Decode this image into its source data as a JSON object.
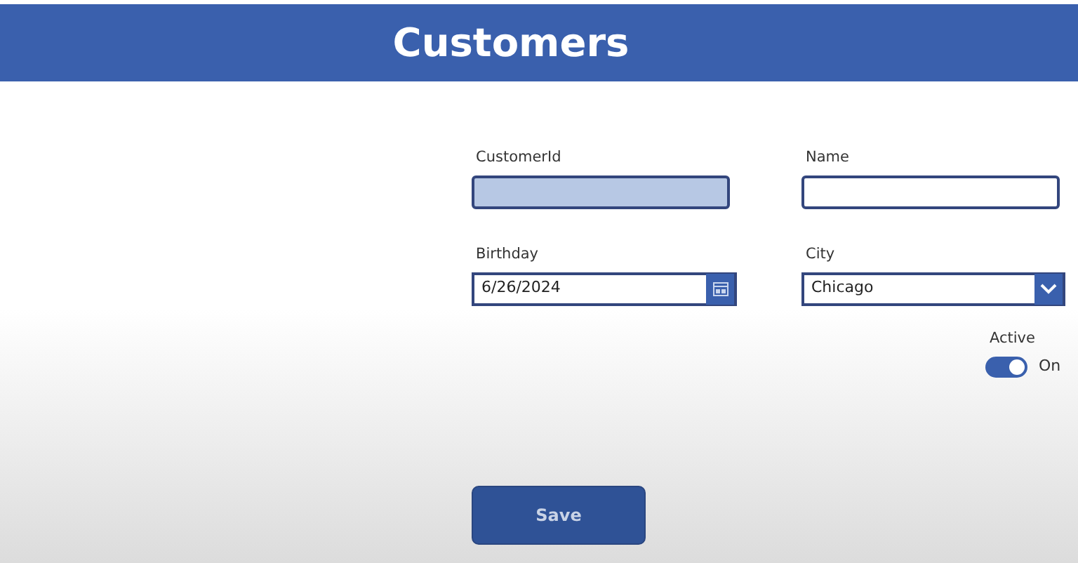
{
  "header": {
    "title": "Customers"
  },
  "fields": [
    {
      "kind": "text",
      "label": "CustomerId",
      "highlighted": true
    },
    {
      "kind": "text",
      "label": "Name",
      "highlighted": false
    },
    {
      "kind": "date",
      "label": "Birthday",
      "value": "6/26/2024",
      "highlighted": false
    },
    {
      "kind": "dropdown",
      "label": "City",
      "value": "Chicago",
      "highlighted": false
    }
  ],
  "toggle": {
    "label": "Active",
    "on": true,
    "text": "On"
  },
  "buttons": [
    {
      "label": "Save"
    }
  ]
}
